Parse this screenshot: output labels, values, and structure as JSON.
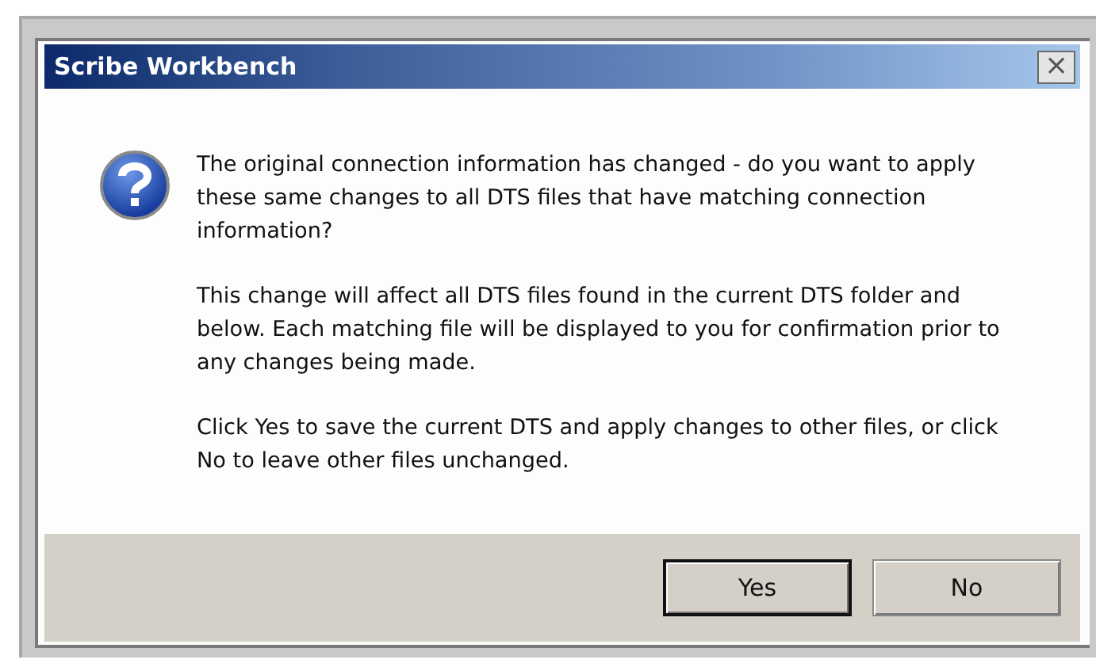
{
  "window": {
    "title": "Scribe Workbench",
    "close": "×"
  },
  "message": {
    "paragraphs": [
      "The original connection information has changed - do you want to apply these same changes to all DTS files that have matching connection information?",
      "This change will affect all DTS files found in the current DTS folder and below. Each matching file will be displayed to you for confirmation prior to any changes being made.",
      "Click Yes to save the current DTS and apply changes to other files, or click No to leave other files unchanged."
    ]
  },
  "buttons": [
    {
      "label": "Yes",
      "default": true
    },
    {
      "label": "No",
      "default": false
    }
  ]
}
